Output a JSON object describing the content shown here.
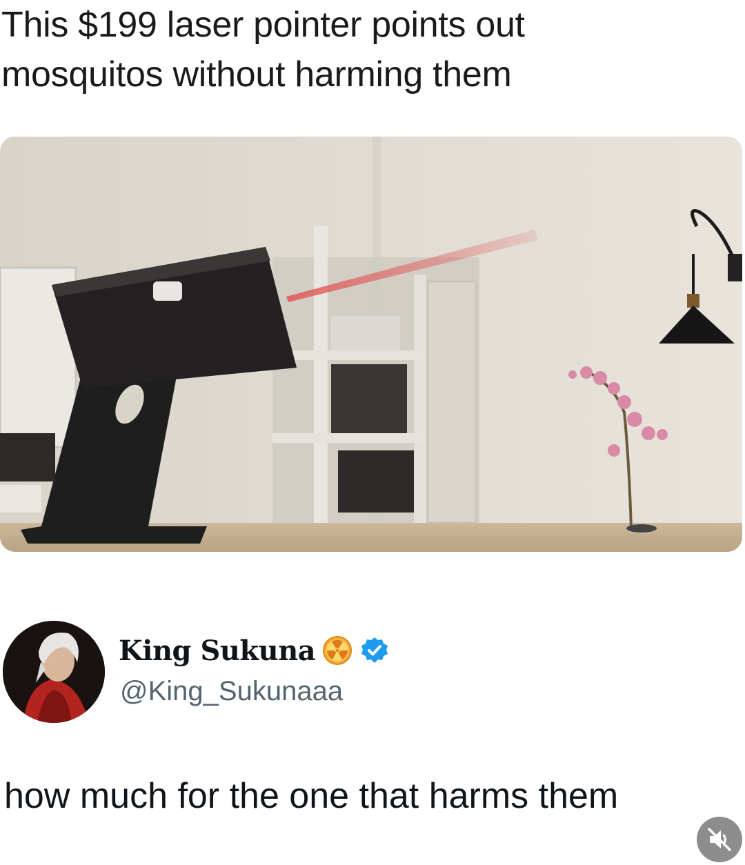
{
  "post": {
    "headline_line1": "This $199 laser pointer points out",
    "headline_line2": "mosquitos without harming them"
  },
  "media": {
    "description_icon": "photo",
    "accent_laser": "#e05a5a"
  },
  "quoted_tweet": {
    "display_name": "King Sukuna",
    "handle": "@King_Sukunaaa",
    "name_emoji_icon": "radioactive-icon",
    "verified_icon": "verified-badge-icon",
    "verified_color": "#1d9bf0",
    "text": "how much for the one that harms them"
  },
  "controls": {
    "mute_icon": "speaker-muted-icon"
  }
}
